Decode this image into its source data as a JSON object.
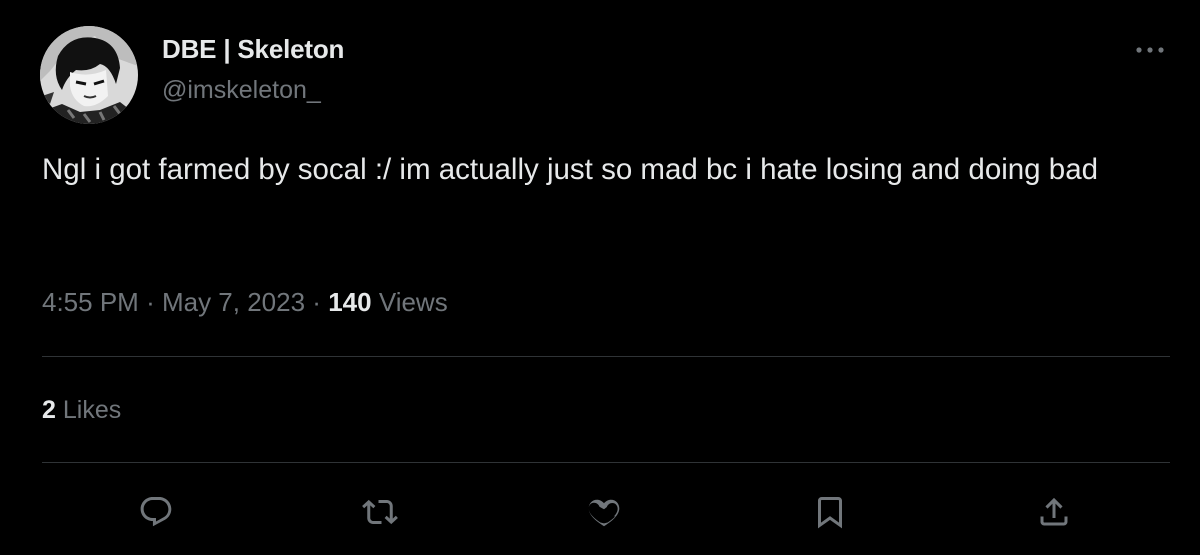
{
  "author": {
    "display_name": "DBE | Skeleton",
    "handle": "@imskeleton_"
  },
  "tweet": {
    "text": "Ngl i got farmed by socal :/ im actually just so mad bc i hate losing and doing bad",
    "time": "4:55 PM",
    "separator": "·",
    "date": "May 7, 2023",
    "views_count": "140",
    "views_label": "Views"
  },
  "engagement": {
    "likes_count": "2",
    "likes_label": "Likes"
  },
  "actions": [
    "reply-icon",
    "retweet-icon",
    "like-icon",
    "bookmark-icon",
    "share-icon"
  ],
  "colors": {
    "background": "#000000",
    "text_primary": "#e7e9ea",
    "text_secondary": "#71767b",
    "divider": "#2f3336"
  }
}
